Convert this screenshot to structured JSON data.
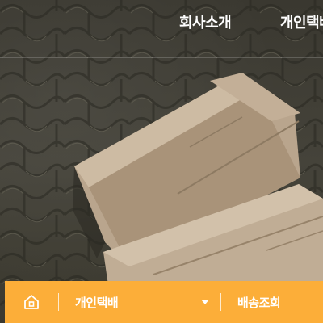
{
  "nav": {
    "items": [
      {
        "label": "회사소개"
      },
      {
        "label": "개인택배"
      }
    ]
  },
  "bottom_bar": {
    "home_icon": "home-icon",
    "selected_service": "개인택배",
    "dropdown_icon": "caret-down-icon",
    "track_label": "배송조회",
    "accent_color": "#fcae39"
  }
}
